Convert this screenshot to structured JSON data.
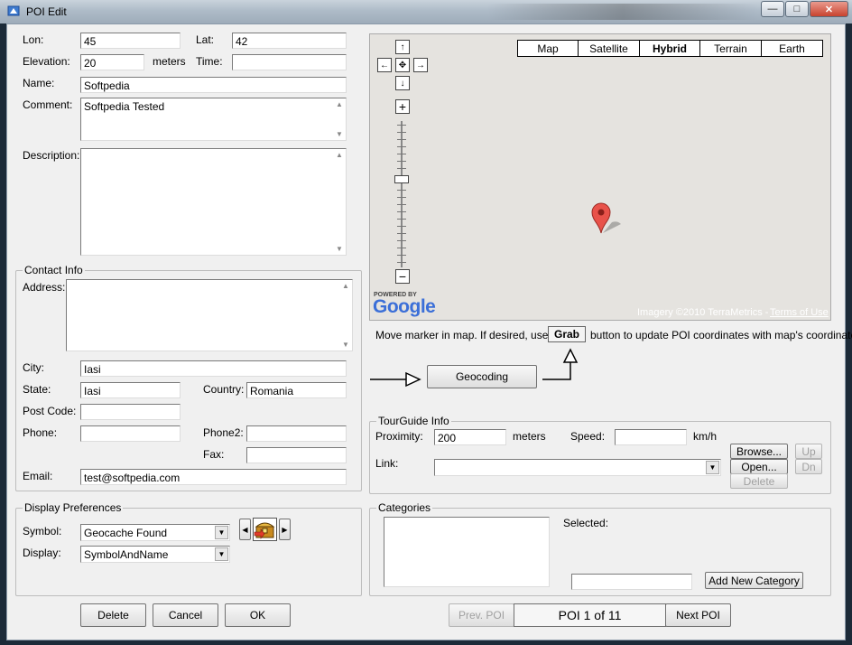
{
  "window": {
    "title": "POI Edit",
    "minimize_glyph": "—",
    "maximize_glyph": "□",
    "close_glyph": "✕"
  },
  "form": {
    "lon": {
      "label": "Lon:",
      "value": "45"
    },
    "lat": {
      "label": "Lat:",
      "value": "42"
    },
    "elevation": {
      "label": "Elevation:",
      "value": "20",
      "unit": "meters"
    },
    "time": {
      "label": "Time:",
      "value": ""
    },
    "name": {
      "label": "Name:",
      "value": "Softpedia"
    },
    "comment": {
      "label": "Comment:",
      "value": "Softpedia Tested"
    },
    "description": {
      "label": "Description:",
      "value": ""
    }
  },
  "contact": {
    "title": "Contact Info",
    "address": {
      "label": "Address:",
      "value": ""
    },
    "city": {
      "label": "City:",
      "value": "Iasi"
    },
    "state": {
      "label": "State:",
      "value": "Iasi"
    },
    "country": {
      "label": "Country:",
      "value": "Romania"
    },
    "post_code": {
      "label": "Post Code:",
      "value": ""
    },
    "phone": {
      "label": "Phone:",
      "value": ""
    },
    "phone2": {
      "label": "Phone2:",
      "value": ""
    },
    "fax": {
      "label": "Fax:",
      "value": ""
    },
    "email": {
      "label": "Email:",
      "value": "test@softpedia.com"
    }
  },
  "display_prefs": {
    "title": "Display Preferences",
    "symbol": {
      "label": "Symbol:",
      "value": "Geocache Found"
    },
    "display": {
      "label": "Display:",
      "value": "SymbolAndName"
    }
  },
  "map": {
    "types": [
      "Map",
      "Satellite",
      "Hybrid",
      "Terrain",
      "Earth"
    ],
    "selected_type": "Hybrid",
    "powered_by": "POWERED BY",
    "google": "Google",
    "imagery": "Imagery ©2010 TerraMetrics -",
    "terms": "Terms of Use",
    "instruction_pre": "Move marker in map. If desired, use the",
    "grab_label": "Grab",
    "instruction_post": "button to update POI coordinates with map's coordinates",
    "geocoding_label": "Geocoding",
    "colors": {
      "marker": "#e8524a",
      "background": "#e5e3df"
    }
  },
  "tourguide": {
    "title": "TourGuide Info",
    "proximity": {
      "label": "Proximity:",
      "value": "200",
      "unit": "meters"
    },
    "speed": {
      "label": "Speed:",
      "value": "",
      "unit": "km/h"
    },
    "link": {
      "label": "Link:",
      "value": ""
    },
    "browse_label": "Browse...",
    "open_label": "Open...",
    "delete_label": "Delete",
    "up_label": "Up",
    "dn_label": "Dn"
  },
  "categories": {
    "title": "Categories",
    "selected_label": "Selected:",
    "new_category_value": "",
    "add_label": "Add New Category"
  },
  "footer": {
    "delete_label": "Delete",
    "cancel_label": "Cancel",
    "ok_label": "OK",
    "prev_label": "Prev. POI",
    "counter": "POI 1 of 11",
    "next_label": "Next POI"
  }
}
